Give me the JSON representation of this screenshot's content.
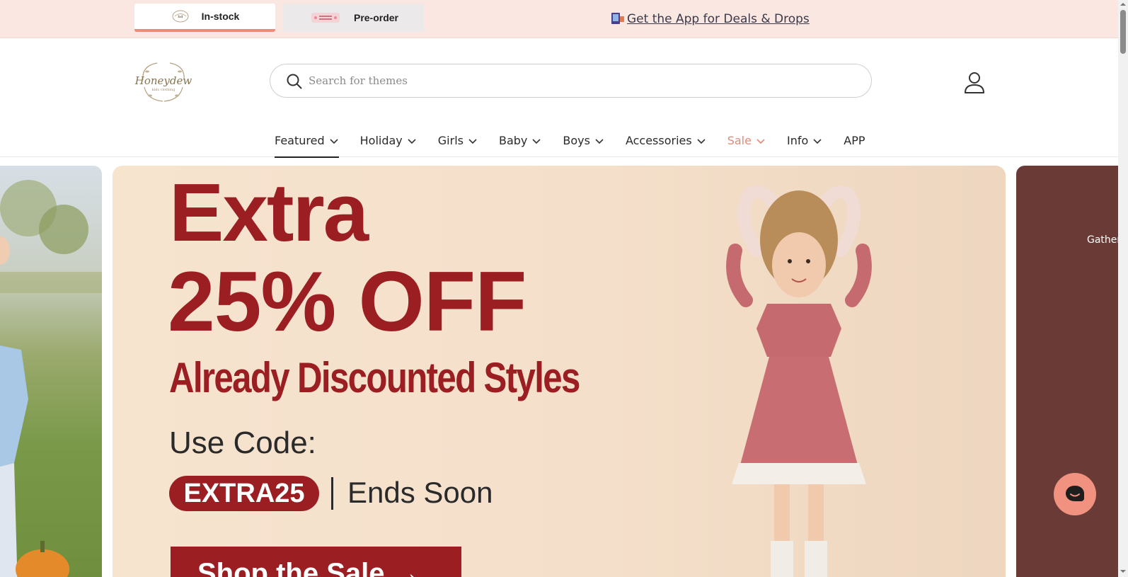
{
  "topbar": {
    "tabs": [
      {
        "label": "In-stock",
        "active": true
      },
      {
        "label": "Pre-order",
        "active": false
      }
    ],
    "app_promo": "Get the App for Deals & Drops"
  },
  "header": {
    "logo_text": "Honeydew",
    "search": {
      "placeholder": "Search for themes",
      "value": ""
    }
  },
  "nav": {
    "items": [
      {
        "label": "Featured"
      },
      {
        "label": "Holiday"
      },
      {
        "label": "Girls"
      },
      {
        "label": "Baby"
      },
      {
        "label": "Boys"
      },
      {
        "label": "Accessories"
      },
      {
        "label": "Sale"
      },
      {
        "label": "Info"
      },
      {
        "label": "APP"
      }
    ]
  },
  "hero": {
    "line1": "Extra",
    "line2": "25% OFF",
    "line3": "Already Discounted Styles",
    "code_label": "Use Code:",
    "code": "EXTRA25",
    "ends": "Ends Soon",
    "cta": "Shop the Sale →"
  },
  "slides": {
    "right_text": "Gather"
  },
  "colors": {
    "topbar_bg": "#fbe7e2",
    "accent": "#ef8a7b",
    "hero_red": "#9b1f22",
    "hero_bg": "#f6e4cf",
    "sale": "#e38b78"
  }
}
